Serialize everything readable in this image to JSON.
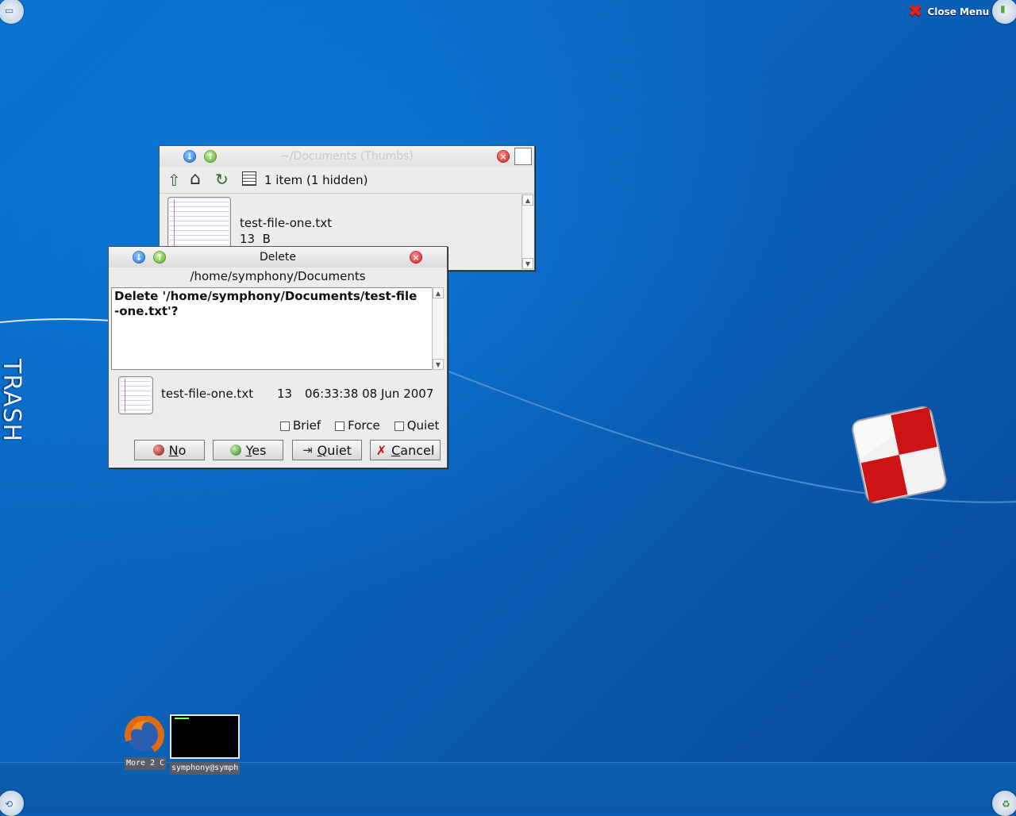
{
  "desktop": {
    "close_menu_label": "Close Menu",
    "trash_label": "TRASH",
    "colors": {
      "background": "#0a5fb8",
      "accent_red": "#d41616"
    }
  },
  "thumbs_window": {
    "title": "~/Documents (Thumbs)",
    "status": "1 item (1 hidden)",
    "file": {
      "name": "test-file-one.txt",
      "size": "13  B"
    }
  },
  "delete_dialog": {
    "title": "Delete",
    "path": "/home/symphony/Documents",
    "message": "Delete '/home/symphony/Documents/test-file-one.txt'?",
    "file": {
      "name": "test-file-one.txt",
      "size": "13",
      "date": "06:33:38 08 Jun 2007"
    },
    "options": [
      {
        "label": "Brief",
        "checked": false
      },
      {
        "label": "Force",
        "checked": false
      },
      {
        "label": "Quiet",
        "checked": false
      }
    ],
    "buttons": {
      "no": {
        "mnemonic": "N",
        "rest": "o"
      },
      "yes": {
        "mnemonic": "Y",
        "rest": "es"
      },
      "quiet": {
        "mnemonic": "Q",
        "rest": "uiet"
      },
      "cancel": {
        "mnemonic": "C",
        "rest": "ancel"
      }
    }
  },
  "taskbar": {
    "items": [
      {
        "label": "More 2 C",
        "icon": "firefox-icon"
      },
      {
        "label": "symphony@symph",
        "icon": "terminal-icon"
      }
    ]
  }
}
